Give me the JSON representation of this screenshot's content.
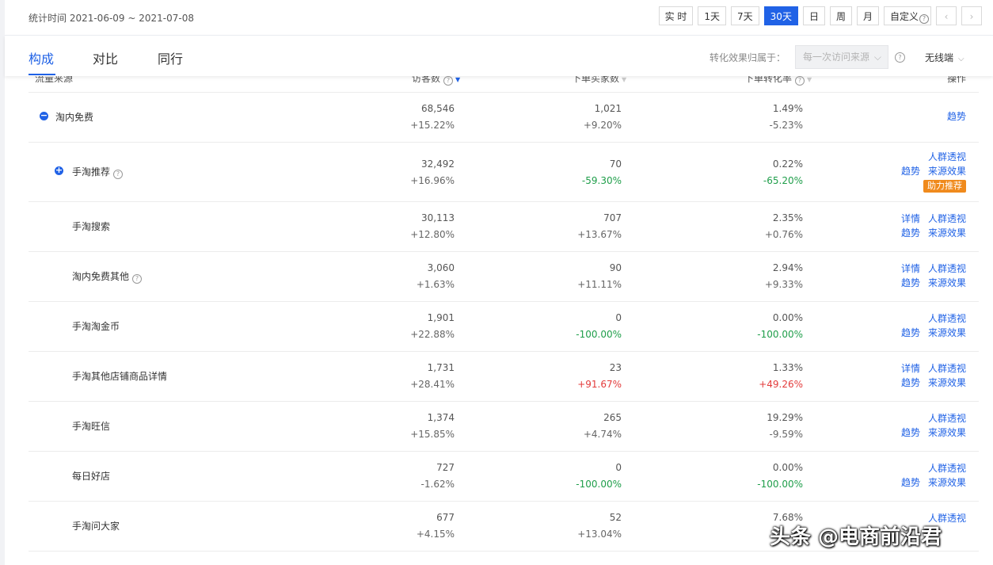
{
  "header": {
    "stat_time": "统计时间 2021-06-09 ~ 2021-07-08",
    "buttons": [
      "实 时",
      "1天",
      "7天",
      "30天",
      "日",
      "周",
      "月"
    ],
    "active": "30天",
    "custom_label": "自定义",
    "prev": "‹",
    "next": "›"
  },
  "tabs": [
    "构成",
    "对比",
    "同行"
  ],
  "attribution": {
    "label": "转化效果归属于：",
    "value": "每一次访问来源",
    "device": "无线端"
  },
  "table": {
    "headers": [
      "流量来源",
      "访客数",
      "下单买家数",
      "下单转化率",
      "操作"
    ],
    "rows": [
      {
        "name": "淘内免费",
        "visitors": "68,546",
        "visitors_chg": "+15.22%",
        "buyers": "1,021",
        "buyers_chg": "+9.20%",
        "rate": "1.49%",
        "rate_chg": "-5.23%",
        "ops": [
          "趋势"
        ]
      },
      {
        "name": "手淘推荐",
        "visitors": "32,492",
        "visitors_chg": "+16.96%",
        "buyers": "70",
        "buyers_chg": "-59.30%",
        "rate": "0.22%",
        "rate_chg": "-65.20%",
        "ops": [
          "人群透视",
          "趋势",
          "来源效果"
        ],
        "badge": "助力推荐"
      },
      {
        "name": "手淘搜索",
        "visitors": "30,113",
        "visitors_chg": "+12.80%",
        "buyers": "707",
        "buyers_chg": "+13.67%",
        "rate": "2.35%",
        "rate_chg": "+0.76%",
        "ops": [
          "详情",
          "人群透视",
          "趋势",
          "来源效果"
        ]
      },
      {
        "name": "淘内免费其他",
        "visitors": "3,060",
        "visitors_chg": "+1.63%",
        "buyers": "90",
        "buyers_chg": "+11.11%",
        "rate": "2.94%",
        "rate_chg": "+9.33%",
        "ops": [
          "详情",
          "人群透视",
          "趋势",
          "来源效果"
        ]
      },
      {
        "name": "手淘淘金币",
        "visitors": "1,901",
        "visitors_chg": "+22.88%",
        "buyers": "0",
        "buyers_chg": "-100.00%",
        "rate": "0.00%",
        "rate_chg": "-100.00%",
        "ops": [
          "人群透视",
          "趋势",
          "来源效果"
        ]
      },
      {
        "name": "手淘其他店铺商品详情",
        "visitors": "1,731",
        "visitors_chg": "+28.41%",
        "buyers": "23",
        "buyers_chg": "+91.67%",
        "rate": "1.33%",
        "rate_chg": "+49.26%",
        "ops": [
          "详情",
          "人群透视",
          "趋势",
          "来源效果"
        ]
      },
      {
        "name": "手淘旺信",
        "visitors": "1,374",
        "visitors_chg": "+15.85%",
        "buyers": "265",
        "buyers_chg": "+4.74%",
        "rate": "19.29%",
        "rate_chg": "-9.59%",
        "ops": [
          "人群透视",
          "趋势",
          "来源效果"
        ]
      },
      {
        "name": "每日好店",
        "visitors": "727",
        "visitors_chg": "-1.62%",
        "buyers": "0",
        "buyers_chg": "-100.00%",
        "rate": "0.00%",
        "rate_chg": "-100.00%",
        "ops": [
          "人群透视",
          "趋势",
          "来源效果"
        ]
      },
      {
        "name": "手淘问大家",
        "visitors": "677",
        "visitors_chg": "+4.15%",
        "buyers": "52",
        "buyers_chg": "+13.04%",
        "rate": "7.68%",
        "rate_chg": "",
        "ops": [
          "人群透视"
        ]
      }
    ]
  },
  "watermark": "头条 @电商前沿君",
  "colors": {
    "accent": "#2062e6",
    "negative": "#1f9e4a",
    "positive": "#e33b3b",
    "badge": "#f08a1c"
  }
}
